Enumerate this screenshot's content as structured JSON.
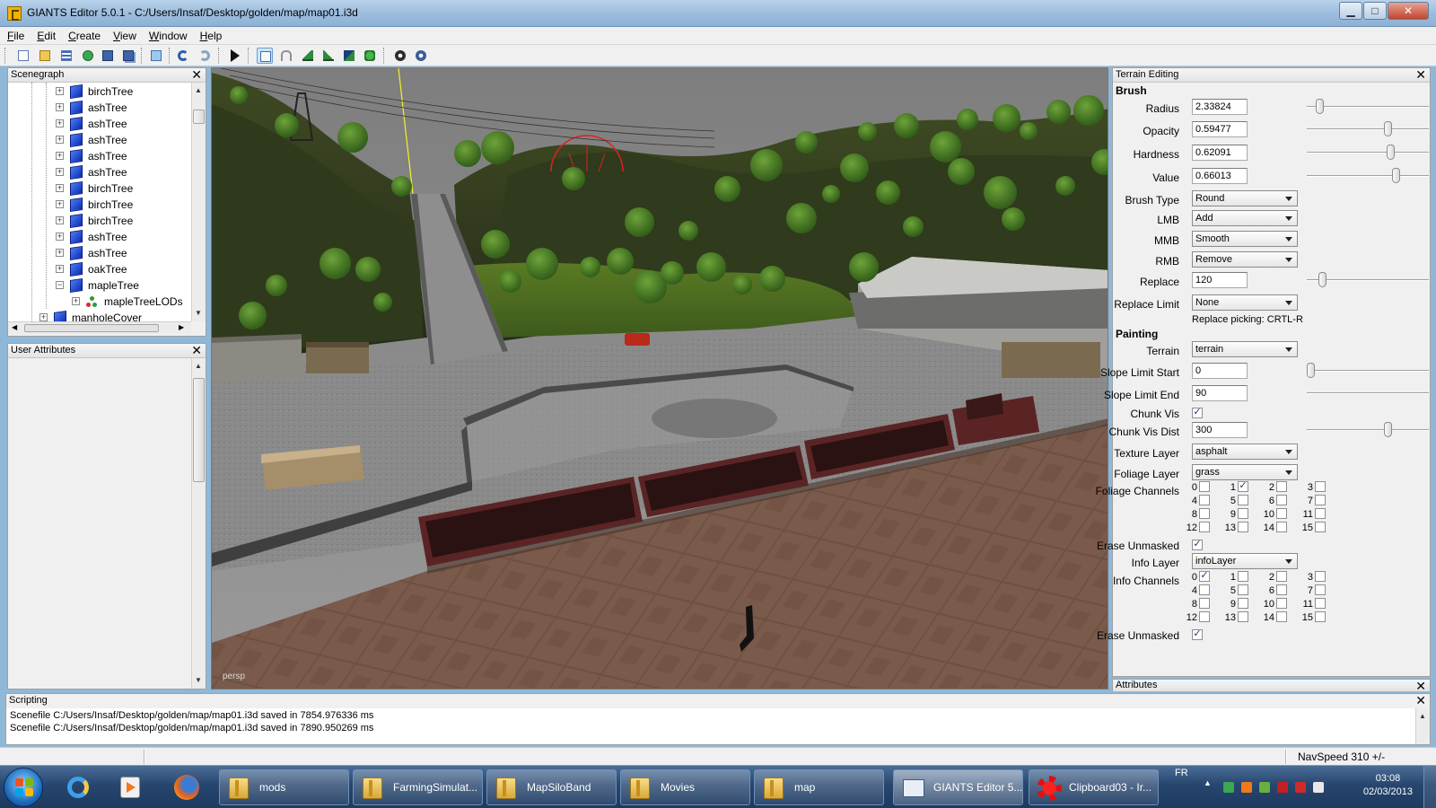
{
  "window": {
    "title": "GIANTS Editor 5.0.1 - C:/Users/Insaf/Desktop/golden/map/map01.i3d",
    "minimize": "▁",
    "maximize": "□",
    "close": "✕"
  },
  "menu": [
    "File",
    "Edit",
    "Create",
    "View",
    "Window",
    "Help"
  ],
  "toolbar_icons": [
    "new-icon",
    "open-icon",
    "list-icon",
    "refresh-icon",
    "save-icon",
    "save-all-icon",
    "import-icon",
    "undo-icon",
    "redo-icon",
    "play-icon",
    "select-icon",
    "move-icon",
    "terrain-raise-icon",
    "terrain-paint-icon",
    "terrain-foliage-icon",
    "foliage-paint-icon",
    "settings-icon",
    "settings-alt-icon"
  ],
  "scenegraph": {
    "title": "Scenegraph",
    "close": "✕",
    "items": [
      {
        "label": "birchTree",
        "expander": "+"
      },
      {
        "label": "ashTree",
        "expander": "+"
      },
      {
        "label": "ashTree",
        "expander": "+"
      },
      {
        "label": "ashTree",
        "expander": "+"
      },
      {
        "label": "ashTree",
        "expander": "+"
      },
      {
        "label": "ashTree",
        "expander": "+"
      },
      {
        "label": "birchTree",
        "expander": "+"
      },
      {
        "label": "birchTree",
        "expander": "+"
      },
      {
        "label": "birchTree",
        "expander": "+"
      },
      {
        "label": "ashTree",
        "expander": "+"
      },
      {
        "label": "ashTree",
        "expander": "+"
      },
      {
        "label": "oakTree",
        "expander": "+"
      },
      {
        "label": "mapleTree",
        "expander": "−"
      },
      {
        "label": "mapleTreeLODs",
        "expander": "+"
      },
      {
        "label": "manholeCover",
        "expander": "+"
      }
    ]
  },
  "user_attributes": {
    "title": "User Attributes",
    "close": "✕"
  },
  "viewport": {
    "camera": "persp"
  },
  "terrain_editing": {
    "title": "Terrain Editing",
    "close": "✕",
    "brush_heading": "Brush",
    "radius": {
      "label": "Radius",
      "value": "2.33824",
      "slider": 0.08
    },
    "opacity": {
      "label": "Opacity",
      "value": "0.59477",
      "slider": 0.68
    },
    "hardness": {
      "label": "Hardness",
      "value": "0.62091",
      "slider": 0.71
    },
    "value": {
      "label": "Value",
      "value": "0.66013",
      "slider": 0.75
    },
    "brush_type": {
      "label": "Brush Type",
      "value": "Round"
    },
    "lmb": {
      "label": "LMB",
      "value": "Add"
    },
    "mmb": {
      "label": "MMB",
      "value": "Smooth"
    },
    "rmb": {
      "label": "RMB",
      "value": "Remove"
    },
    "replace": {
      "label": "Replace",
      "value": "120",
      "slider": 0.1
    },
    "replace_limit": {
      "label": "Replace Limit",
      "value": "None"
    },
    "replace_note": "Replace picking: CRTL-R",
    "painting_heading": "Painting",
    "terrain": {
      "label": "Terrain",
      "value": "terrain"
    },
    "slope_start": {
      "label": "Slope Limit Start",
      "value": "0",
      "slider": 0.0
    },
    "slope_end": {
      "label": "Slope Limit End",
      "value": "90"
    },
    "chunk_vis": {
      "label": "Chunk Vis",
      "checked": true,
      "mark": "✓"
    },
    "chunk_vis_dist": {
      "label": "Chunk Vis Dist",
      "value": "300",
      "slider": 0.68
    },
    "texture_layer": {
      "label": "Texture Layer",
      "value": "asphalt"
    },
    "foliage_layer": {
      "label": "Foliage Layer",
      "value": "grass"
    },
    "foliage_channels": {
      "label": "Foliage Channels",
      "checked": [
        1
      ]
    },
    "erase_unmasked_1": {
      "label": "Erase Unmasked",
      "checked": true,
      "mark": "✓"
    },
    "info_layer": {
      "label": "Info Layer",
      "value": "infoLayer"
    },
    "info_channels": {
      "label": "Info Channels",
      "checked": [
        0
      ]
    },
    "erase_unmasked_2": {
      "label": "Erase Unmasked",
      "checked": true,
      "mark": "✓"
    },
    "channel_numbers": [
      "0",
      "1",
      "2",
      "3",
      "4",
      "5",
      "6",
      "7",
      "8",
      "9",
      "10",
      "11",
      "12",
      "13",
      "14",
      "15"
    ]
  },
  "attributes": {
    "title": "Attributes",
    "close": "✕"
  },
  "scripting": {
    "title": "Scripting",
    "close": "✕",
    "lines": [
      "Scenefile C:/Users/Insaf/Desktop/golden/map/map01.i3d saved in 7854.976336 ms",
      "Scenefile C:/Users/Insaf/Desktop/golden/map/map01.i3d saved in 7890.950269 ms"
    ]
  },
  "status": {
    "navspeed": "NavSpeed 310 +/-"
  },
  "taskbar": {
    "pinned": [
      "ie-icon",
      "media-player-icon",
      "firefox-icon"
    ],
    "tasks": [
      {
        "label": "mods",
        "icon": "folder-icon"
      },
      {
        "label": "FarmingSimulat...",
        "icon": "folder-icon"
      },
      {
        "label": "MapSiloBand",
        "icon": "folder-icon"
      },
      {
        "label": "Movies",
        "icon": "folder-icon"
      },
      {
        "label": "map",
        "icon": "folder-icon"
      },
      {
        "label": "GIANTS Editor 5...",
        "icon": "giants-editor-icon",
        "active": true
      },
      {
        "label": "Clipboard03 - Ir...",
        "icon": "irfanview-icon"
      }
    ],
    "language": "FR",
    "time": "03:08",
    "date": "02/03/2013"
  }
}
